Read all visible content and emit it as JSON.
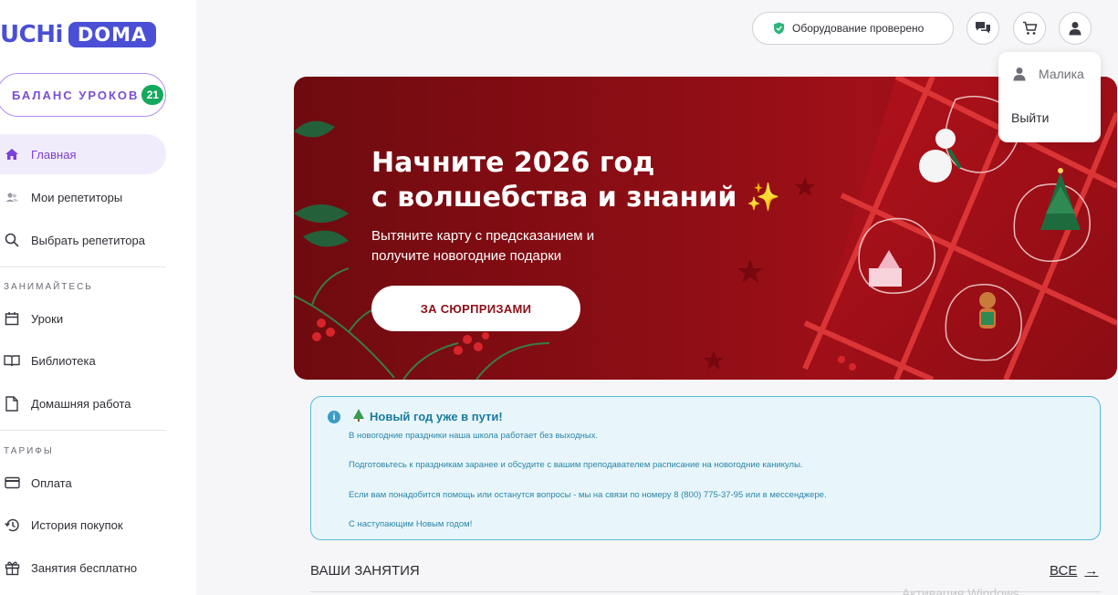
{
  "logo": {
    "part1": "UCHi",
    "part2": "DOMA"
  },
  "balance": {
    "label": "БАЛАНС УРОКОВ",
    "count": "21"
  },
  "nav": {
    "home": "Главная",
    "tutors": "Мои репетиторы",
    "choose": "Выбрать репетитора",
    "section_study": "ЗАНИМАЙТЕСЬ",
    "lessons": "Уроки",
    "library": "Библиотека",
    "homework": "Домашняя работа",
    "section_tariffs": "ТАРИФЫ",
    "payment": "Оплата",
    "history": "История покупок",
    "free": "Занятия бесплатно"
  },
  "header": {
    "equipment_status": "Оборудование проверено"
  },
  "user_menu": {
    "name": "Малика",
    "logout": "Выйти"
  },
  "banner": {
    "title_line1": "Начните 2026 год",
    "title_line2": "с волшебства и знаний ✨",
    "subtitle": "Вытяните карту с предсказанием и получите новогодние подарки",
    "button": "ЗА СЮРПРИЗАМИ"
  },
  "notice": {
    "icon": "i",
    "title": "Новый год уже в пути!",
    "lines": [
      "В новогодние праздники наша школа работает без выходных.",
      "Подготовьтесь к праздникам заранее и обсудите с вашим преподавателем расписание на новогодние каникулы.",
      "Если вам понадобится помощь или останутся вопросы - мы на связи по номеру 8 (800) 775-37-95 или в мессенджере.",
      "С наступающим Новым годом!"
    ]
  },
  "lessons": {
    "title": "ВАШИ ЗАНЯТИЯ",
    "all": "ВСЕ",
    "arrow": "→"
  },
  "watermark": "Активация Windows",
  "colors": {
    "brand": "#4a4fd6",
    "accent_purple": "#7a3fd6",
    "balance_badge": "#15a85e",
    "banner_red": "#8a0d14",
    "notice_bg": "#e8f6fb",
    "notice_border": "#5bbad6"
  }
}
